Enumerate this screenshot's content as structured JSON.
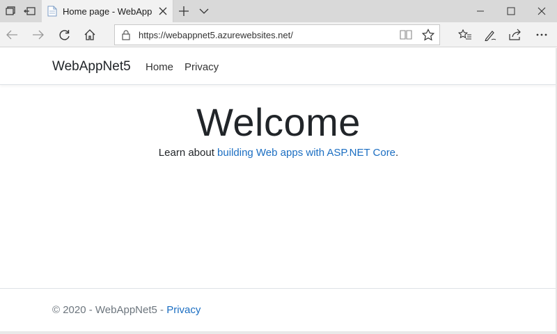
{
  "browser": {
    "tab": {
      "title": "Home page - WebAppN"
    },
    "address": {
      "url": "https://webappnet5.azurewebsites.net/"
    }
  },
  "site": {
    "brand": "WebAppNet5",
    "nav": [
      {
        "label": "Home"
      },
      {
        "label": "Privacy"
      }
    ],
    "hero": {
      "heading": "Welcome",
      "lead_prefix": "Learn about ",
      "lead_link": "building Web apps with ASP.NET Core",
      "lead_suffix": "."
    },
    "footer": {
      "text": "© 2020 - WebAppNet5 - ",
      "link": "Privacy"
    }
  },
  "colors": {
    "link": "#1b6ec2",
    "tabbar": "#d9d9d9",
    "toolbar": "#f2f2f2"
  }
}
